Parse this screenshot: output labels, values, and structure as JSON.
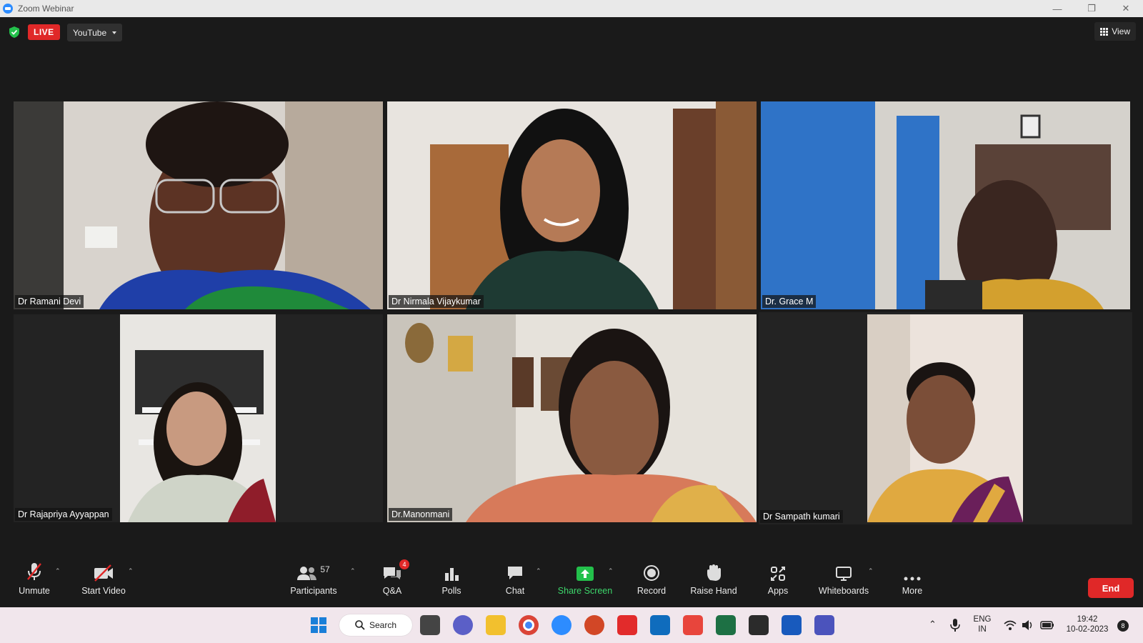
{
  "window": {
    "title": "Zoom Webinar"
  },
  "topbar": {
    "live_label": "LIVE",
    "stream_target": "YouTube",
    "view_label": "View"
  },
  "participants": [
    {
      "name": "Dr Ramani Devi"
    },
    {
      "name": "Dr Nirmala Vijaykumar"
    },
    {
      "name": "Dr. Grace M"
    },
    {
      "name": "Dr Rajapriya Ayyappan"
    },
    {
      "name": "Dr.Manonmani"
    },
    {
      "name": "Dr Sampath kumari",
      "active_speaker": true
    }
  ],
  "toolbar": {
    "unmute": "Unmute",
    "start_video": "Start Video",
    "participants": "Participants",
    "participants_count": "57",
    "qa": "Q&A",
    "qa_badge": "4",
    "polls": "Polls",
    "chat": "Chat",
    "share_screen": "Share Screen",
    "record": "Record",
    "raise_hand": "Raise Hand",
    "apps": "Apps",
    "whiteboards": "Whiteboards",
    "more": "More",
    "end": "End"
  },
  "taskbar": {
    "search_label": "Search",
    "language": "ENG",
    "region": "IN",
    "time": "19:42",
    "date": "10-02-2023",
    "notification_count": "8"
  },
  "colors": {
    "live": "#e02828",
    "share": "#3dd66b",
    "active_border": "#d5e86a",
    "zoom_blue": "#2d8cff"
  }
}
